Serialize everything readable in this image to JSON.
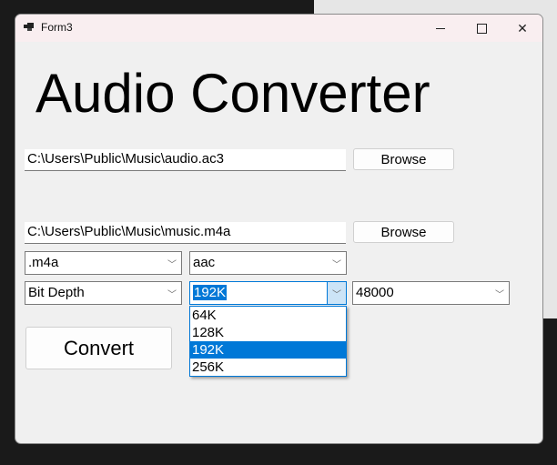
{
  "window": {
    "title": "Form3",
    "controls": {
      "minimize": "minimize",
      "maximize": "maximize",
      "close": "close"
    }
  },
  "heading": "Audio Converter",
  "input_file": {
    "value": "C:\\Users\\Public\\Music\\audio.ac3",
    "browse_label": "Browse"
  },
  "output_file": {
    "value": "C:\\Users\\Public\\Music\\music.m4a",
    "browse_label": "Browse"
  },
  "format_combo": {
    "value": ".m4a"
  },
  "codec_combo": {
    "value": "aac"
  },
  "bitdepth_combo": {
    "value": "Bit Depth"
  },
  "bitrate_combo": {
    "value": "192K",
    "options": [
      "64K",
      "128K",
      "192K",
      "256K"
    ],
    "selected_index": 2
  },
  "samplerate_combo": {
    "value": "48000"
  },
  "convert_label": "Convert",
  "colors": {
    "accent": "#0078d7",
    "titlebar": "#f9eef0",
    "window_bg": "#f0f0f0"
  }
}
